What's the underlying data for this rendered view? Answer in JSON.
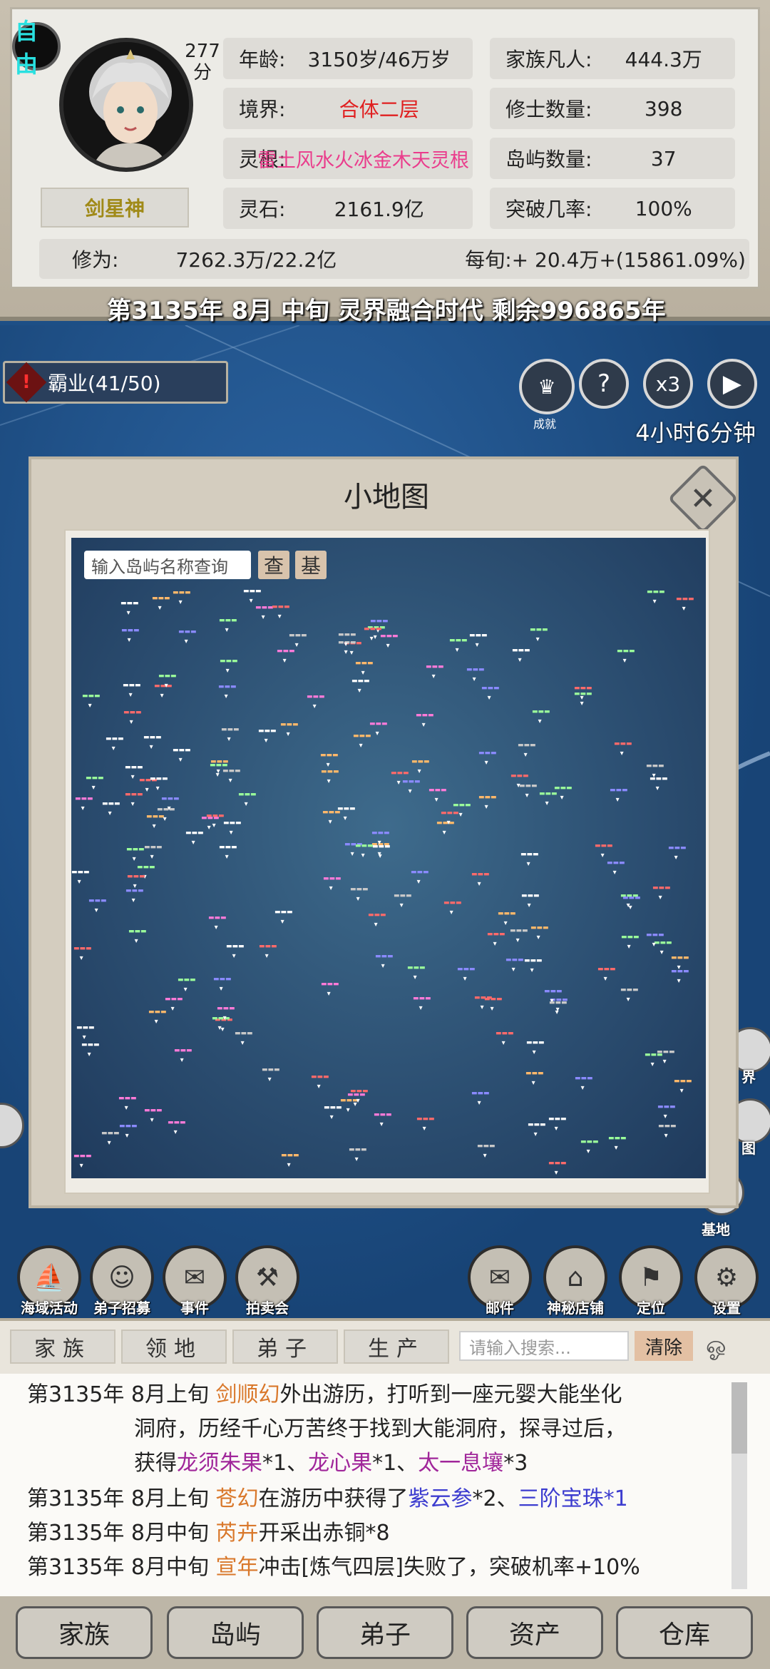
{
  "player": {
    "status_badge": "自由",
    "score": "277",
    "score_unit": "分",
    "name": "剑星神"
  },
  "stats": {
    "age_label": "年龄:",
    "age_value": "3150岁/46万岁",
    "realm_label": "境界:",
    "realm_value": "合体二层",
    "root_label": "灵根:",
    "root_value": "雷土风水火冰金木天灵根",
    "stones_label": "灵石:",
    "stones_value": "2161.9亿",
    "mortals_label": "家族凡人:",
    "mortals_value": "444.3万",
    "cultivators_label": "修士数量:",
    "cultivators_value": "398",
    "islands_label": "岛屿数量:",
    "islands_value": "37",
    "breakthrough_label": "突破几率:",
    "breakthrough_value": "100%",
    "cultivation_label": "修为:",
    "cultivation_value": "7262.3万/22.2亿",
    "per_period_label": "每旬:",
    "per_period_value": "+ 20.4万+(15861.09%)"
  },
  "date_banner": "第3135年 8月 中旬  灵界融合时代 剩余996865年",
  "hud": {
    "ba_label": "霸业(41/50)",
    "achievements_label": "成就",
    "help_label": "?",
    "speed_label": "x3",
    "timer": "4小时6分钟"
  },
  "minimap": {
    "title": "小地图",
    "search_placeholder": "输入岛屿名称查询",
    "query_button": "查",
    "base_button": "基"
  },
  "actions_left": [
    {
      "label": "海域活动",
      "icon": "sea-activity-icon"
    },
    {
      "label": "弟子招募",
      "icon": "recruit-icon"
    },
    {
      "label": "事件",
      "icon": "event-scroll-icon"
    },
    {
      "label": "拍卖会",
      "icon": "auction-hammer-icon"
    }
  ],
  "actions_right": [
    {
      "label": "邮件",
      "icon": "mail-icon"
    },
    {
      "label": "神秘店铺",
      "icon": "shop-icon"
    },
    {
      "label": "定位",
      "icon": "locate-flag-icon"
    },
    {
      "label": "设置",
      "icon": "gear-icon"
    }
  ],
  "side_partial": {
    "world_label": "界",
    "map_label": "图",
    "base_label": "基地"
  },
  "log": {
    "tabs": [
      "家族",
      "领地",
      "弟子",
      "生产"
    ],
    "search_placeholder": "请输入搜索...",
    "clear_label": "清除",
    "entries": [
      {
        "date": "第3135年 8月上旬",
        "name": "剑顺幻",
        "text1": "外出游历，打听到一座元婴大能坐化",
        "text2": "洞府，历经千心万苦终于找到大能洞府，探寻过后，",
        "text3_pre": "获得",
        "item1": "龙须朱果",
        "q1": "*1、",
        "item2": "龙心果",
        "q2": "*1、",
        "item3": "太一息壤",
        "q3": "*3"
      },
      {
        "date": "第3135年 8月上旬",
        "name": "苍幻",
        "text1": "在游历中获得了",
        "item1": "紫云参",
        "q1": "*2、",
        "item2": "三阶宝珠",
        "q2": "*1"
      },
      {
        "date": "第3135年 8月中旬",
        "name": "芮卉",
        "text1": "开采出赤铜*8"
      },
      {
        "date": "第3135年 8月中旬",
        "name": "宣年",
        "text1": "冲击[炼气四层]失败了，突破机率+10%"
      }
    ]
  },
  "nav": [
    "家族",
    "岛屿",
    "弟子",
    "资产",
    "仓库"
  ],
  "colors": {
    "realm": "#e02020",
    "root": "#ea3c8c",
    "log_name": "#d9782b",
    "log_item_purple": "#a0269a",
    "log_item_blue": "#3c3ccf",
    "free_badge": "#29e0e0"
  }
}
